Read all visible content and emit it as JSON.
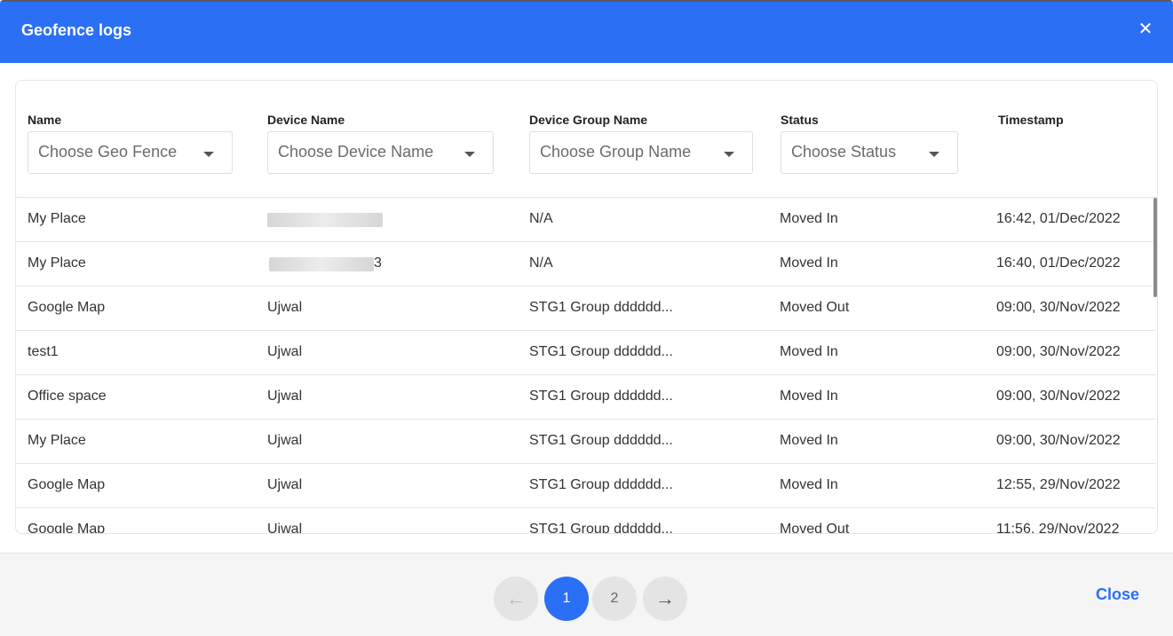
{
  "header": {
    "title": "Geofence logs",
    "close_icon": "close-icon"
  },
  "filters": [
    {
      "label": "Name",
      "placeholder": "Choose Geo Fence"
    },
    {
      "label": "Device Name",
      "placeholder": "Choose Device Name"
    },
    {
      "label": "Device Group Name",
      "placeholder": "Choose Group Name"
    },
    {
      "label": "Status",
      "placeholder": "Choose Status"
    },
    {
      "label": "Timestamp"
    }
  ],
  "rows": [
    {
      "name": "My Place",
      "device": "",
      "group": "N/A",
      "status": "Moved In",
      "timestamp": "16:42, 01/Dec/2022"
    },
    {
      "name": "My Place",
      "device": "3",
      "group": "N/A",
      "status": "Moved In",
      "timestamp": "16:40, 01/Dec/2022"
    },
    {
      "name": "Google Map",
      "device": "Ujwal",
      "group": "STG1 Group dddddd...",
      "status": "Moved Out",
      "timestamp": "09:00, 30/Nov/2022"
    },
    {
      "name": "test1",
      "device": "Ujwal",
      "group": "STG1 Group dddddd...",
      "status": "Moved In",
      "timestamp": "09:00, 30/Nov/2022"
    },
    {
      "name": "Office space",
      "device": "Ujwal",
      "group": "STG1 Group dddddd...",
      "status": "Moved In",
      "timestamp": "09:00, 30/Nov/2022"
    },
    {
      "name": "My Place",
      "device": "Ujwal",
      "group": "STG1 Group dddddd...",
      "status": "Moved In",
      "timestamp": "09:00, 30/Nov/2022"
    },
    {
      "name": "Google Map",
      "device": "Ujwal",
      "group": "STG1 Group dddddd...",
      "status": "Moved In",
      "timestamp": "12:55, 29/Nov/2022"
    },
    {
      "name": "Google Map",
      "device": "Ujwal",
      "group": "STG1 Group dddddd...",
      "status": "Moved Out",
      "timestamp": "11:56, 29/Nov/2022"
    }
  ],
  "pagination": {
    "prev_icon": "arrow-left-icon",
    "pages": [
      "1",
      "2"
    ],
    "current": "1",
    "next_icon": "arrow-right-icon"
  },
  "footer": {
    "close_label": "Close"
  },
  "colors": {
    "primary": "#2b6ff5"
  }
}
